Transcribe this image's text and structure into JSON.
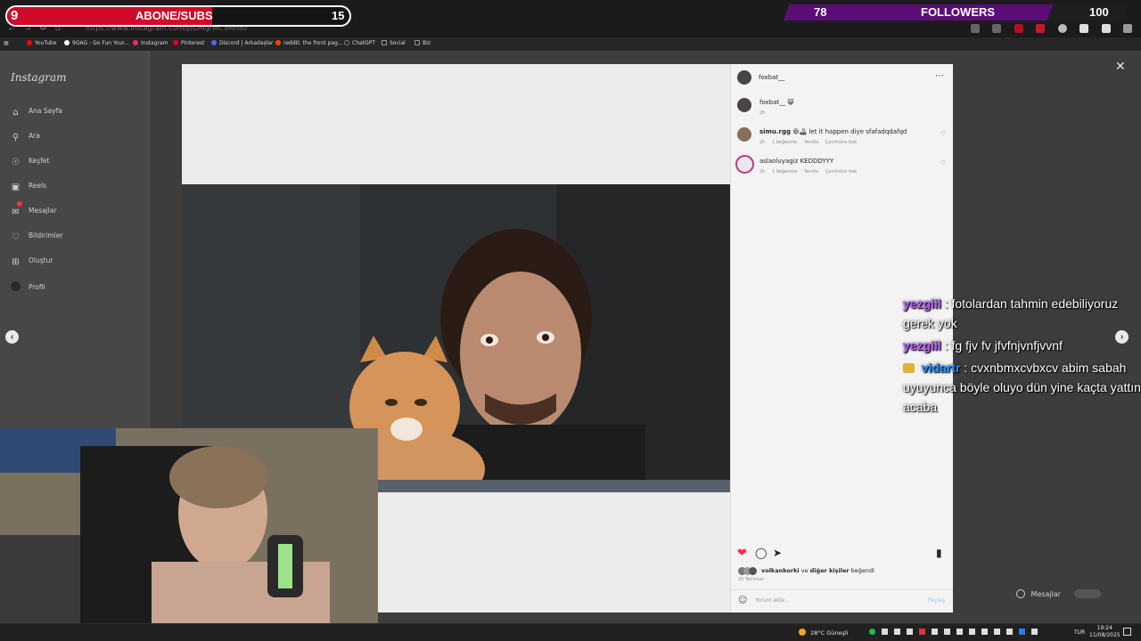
{
  "browser": {
    "url": "https://www.instagram.com/p/DMgrMC9Mh8I/",
    "bookmarks": [
      {
        "label": "YouTube",
        "color": "#ff0000"
      },
      {
        "label": "9GAG - Go Fun Your...",
        "color": "#ffffff"
      },
      {
        "label": "Instagram",
        "color": "#e1306c"
      },
      {
        "label": "Pinterest",
        "color": "#e60023"
      },
      {
        "label": "Discord | Arkadaşlar",
        "color": "#5865f2"
      },
      {
        "label": "reddit: the front pag...",
        "color": "#ff4500"
      },
      {
        "label": "ChatGPT",
        "color": "#222222"
      },
      {
        "label": "Social",
        "color": "#9a9a9a"
      },
      {
        "label": "Biz",
        "color": "#9a9a9a"
      }
    ]
  },
  "sidebar": {
    "logo": "Instagram",
    "items": [
      {
        "label": "Ana Sayfa",
        "icon": "home-icon"
      },
      {
        "label": "Ara",
        "icon": "search-icon"
      },
      {
        "label": "Keşfet",
        "icon": "compass-icon"
      },
      {
        "label": "Reels",
        "icon": "reels-icon"
      },
      {
        "label": "Mesajlar",
        "icon": "messenger-icon"
      },
      {
        "label": "Bildirimler",
        "icon": "heart-icon"
      },
      {
        "label": "Oluştur",
        "icon": "plus-square-icon"
      },
      {
        "label": "Profil",
        "icon": "profile-avatar-icon"
      }
    ]
  },
  "post": {
    "author": "foxbat__",
    "caption_user": "foxbat__",
    "caption_text": "😸",
    "caption_time": "2h",
    "comments": [
      {
        "user": "simu.rgg",
        "text": "😆🚢 let it happen diye sfafadqdafqd",
        "time": "2h",
        "likes": "1 beğenme",
        "reply": "Yanıtla",
        "translate": "Çevirisine bak"
      },
      {
        "user": "aslaoluyagiz",
        "text": "KEDDDYYY",
        "time": "2h",
        "likes": "1 beğenme",
        "reply": "Yanıtla",
        "translate": "Çevirisine bak"
      }
    ],
    "liked_by_user": "volkankorki",
    "liked_by_mid": "ve",
    "liked_by_rest": "diğer kişiler",
    "liked_by_suffix": "beğendi",
    "date": "25 Temmuz",
    "comment_placeholder": "Yorum ekle...",
    "share_label": "Paylaş"
  },
  "overlay": {
    "subs": {
      "current": "9",
      "label": "ABONE/SUBS",
      "goal": "15",
      "progress": 0.6,
      "fill_color": "#d10a2a"
    },
    "followers": {
      "current": "78",
      "label": "FOLLOWERS",
      "goal": "100",
      "progress": 0.78,
      "fill_color": "#5c0d78"
    },
    "chat": [
      {
        "user": "yezgiil",
        "color": "#b35bff",
        "text": ": fotolardan tahmin edebiliyoruz gerek yok",
        "badge": false
      },
      {
        "user": "yezgiil",
        "color": "#b35bff",
        "text": ": fg fjv fv jfvfnjvnfjvvnf",
        "badge": false
      },
      {
        "user": "vidartr",
        "color": "#1e90ff",
        "text": ": cvxnbmxcvbxcv abim sabah uyuyunca böyle oluyo dün yine kaçta yattın acaba",
        "badge": true
      }
    ]
  },
  "messages_pill": {
    "label": "Mesajlar"
  },
  "taskbar": {
    "weather": "28°C  Güneşli",
    "lang": "TUR",
    "time": "19:24",
    "date": "11/08/2025"
  }
}
